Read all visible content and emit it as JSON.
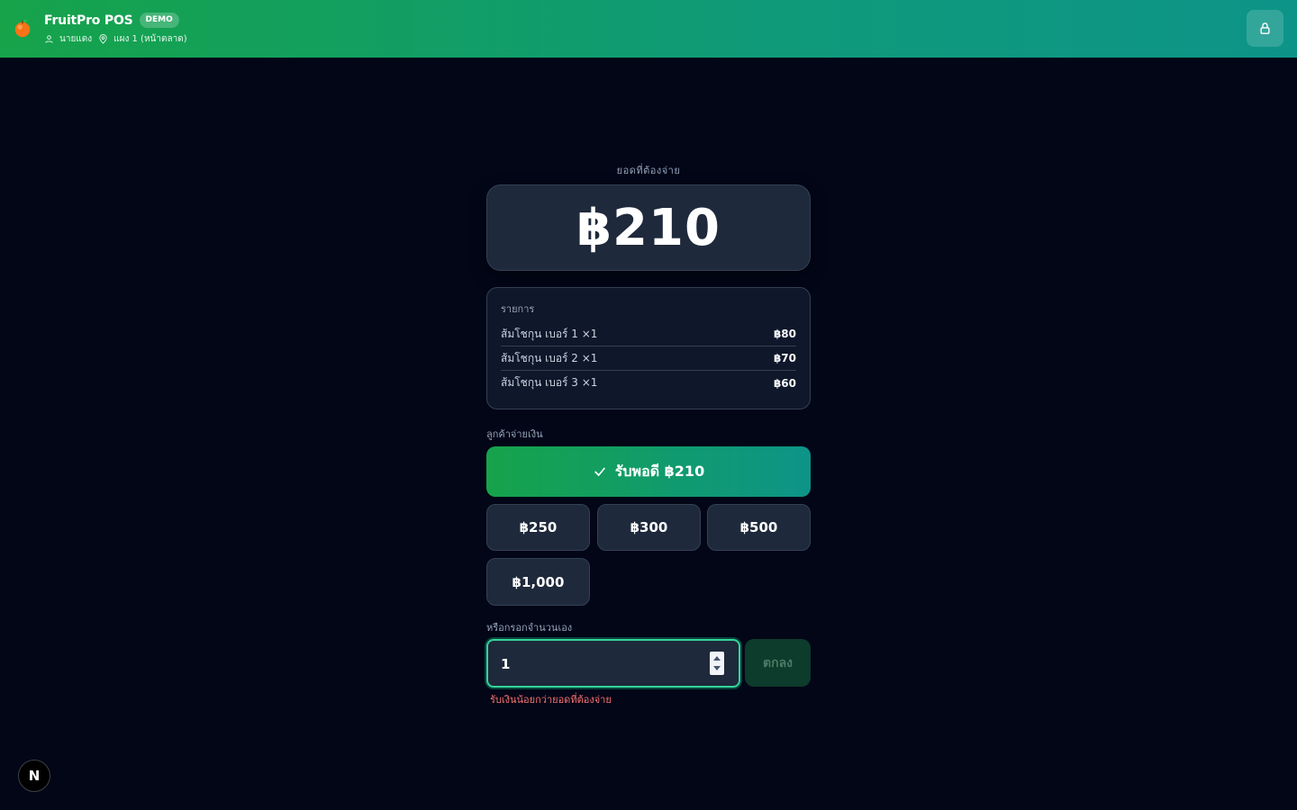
{
  "header": {
    "brand_name": "FruitPro POS",
    "badge": "DEMO",
    "user": "นายแดง",
    "location": "แผง 1 (หน้าตลาด)",
    "logo_icon": "orange-fruit-icon",
    "user_icon": "user-icon",
    "location_icon": "map-pin-icon",
    "lock_icon": "lock-icon"
  },
  "total": {
    "label": "ยอดที่ต้องจ่าย",
    "amount": "฿210"
  },
  "items": {
    "heading": "รายการ",
    "rows": [
      {
        "name": "ส้มโชกุน เบอร์ 1 ×1",
        "price": "฿80"
      },
      {
        "name": "ส้มโชกุน เบอร์ 2 ×1",
        "price": "฿70"
      },
      {
        "name": "ส้มโชกุน เบอร์ 3 ×1",
        "price": "฿60"
      }
    ]
  },
  "payment": {
    "label": "ลูกค้าจ่ายเงิน",
    "exact_label": "รับพอดี ฿210",
    "exact_icon": "check-icon",
    "quick_amounts": [
      "฿250",
      "฿300",
      "฿500",
      "฿1,000"
    ],
    "custom_label": "หรือกรอกจำนวนเอง",
    "custom_value": "1",
    "confirm_label": "ตกลง",
    "error": "รับเงินน้อยกว่ายอดที่ต้องจ่าย"
  },
  "dev_badge": "N",
  "colors": {
    "accent_green": "#16a34a",
    "accent_teal": "#0d9488",
    "background": "#020617",
    "card": "#1e293b",
    "error": "#f87171"
  }
}
